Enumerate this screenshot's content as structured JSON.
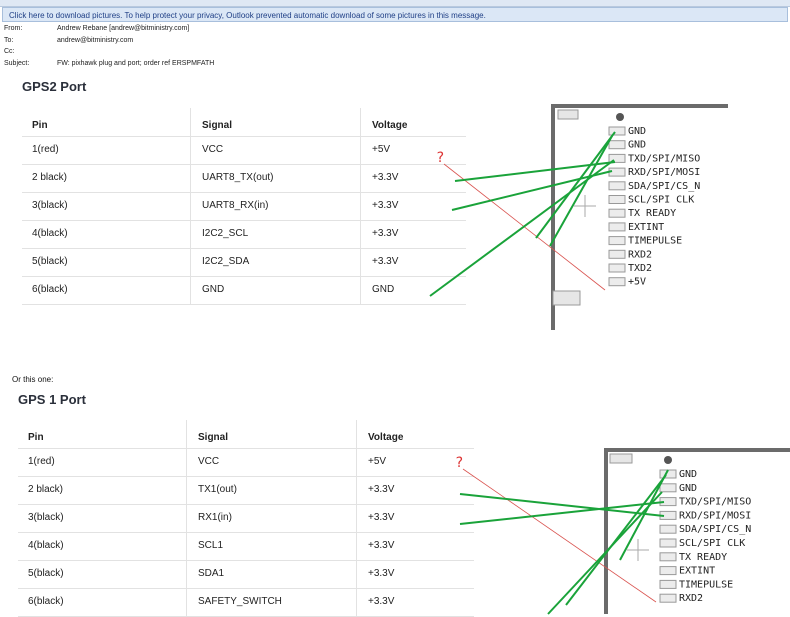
{
  "infobar": {
    "text": "Click here to download pictures. To help protect your privacy, Outlook prevented automatic download of some pictures in this message."
  },
  "email": {
    "from_label": "From:",
    "from_value": "Andrew Rebane [andrew@bitministry.com]",
    "to_label": "To:",
    "to_value": "andrew@bitministry.com",
    "cc_label": "Cc:",
    "cc_value": "",
    "subject_label": "Subject:",
    "subject_value": "FW: pixhawk plug and port; order ref ERSPMFATH"
  },
  "gps2": {
    "title": "GPS2 Port",
    "headers": [
      "Pin",
      "Signal",
      "Voltage"
    ],
    "rows": [
      [
        "1(red)",
        "VCC",
        "+5V"
      ],
      [
        "2 black)",
        "UART8_TX(out)",
        "+3.3V"
      ],
      [
        "3(black)",
        "UART8_RX(in)",
        "+3.3V"
      ],
      [
        "4(black)",
        "I2C2_SCL",
        "+3.3V"
      ],
      [
        "5(black)",
        "I2C2_SDA",
        "+3.3V"
      ],
      [
        "6(black)",
        "GND",
        "GND"
      ]
    ],
    "question": "?",
    "pins": [
      "GND",
      "GND",
      "TXD/SPI/MISO",
      "RXD/SPI/MOSI",
      "SDA/SPI/CS_N",
      "SCL/SPI CLK",
      "TX READY",
      "EXTINT",
      "TIMEPULSE",
      "RXD2",
      "TXD2",
      "+5V"
    ]
  },
  "or_text": "Or this one:",
  "gps1": {
    "title": "GPS 1 Port",
    "headers": [
      "Pin",
      "Signal",
      "Voltage"
    ],
    "rows": [
      [
        "1(red)",
        "VCC",
        "+5V"
      ],
      [
        "2 black)",
        "TX1(out)",
        "+3.3V"
      ],
      [
        "3(black)",
        "RX1(in)",
        "+3.3V"
      ],
      [
        "4(black)",
        "SCL1",
        "+3.3V"
      ],
      [
        "5(black)",
        "SDA1",
        "+3.3V"
      ],
      [
        "6(black)",
        "SAFETY_SWITCH",
        "+3.3V"
      ]
    ],
    "question": "?",
    "pins": [
      "GND",
      "GND",
      "TXD/SPI/MISO",
      "RXD/SPI/MOSI",
      "SDA/SPI/CS_N",
      "SCL/SPI CLK",
      "TX READY",
      "EXTINT",
      "TIMEPULSE",
      "RXD2"
    ]
  },
  "colors": {
    "wire": "#1aa33a",
    "question_line": "#d9534f",
    "connector": "#6b6b6b"
  }
}
